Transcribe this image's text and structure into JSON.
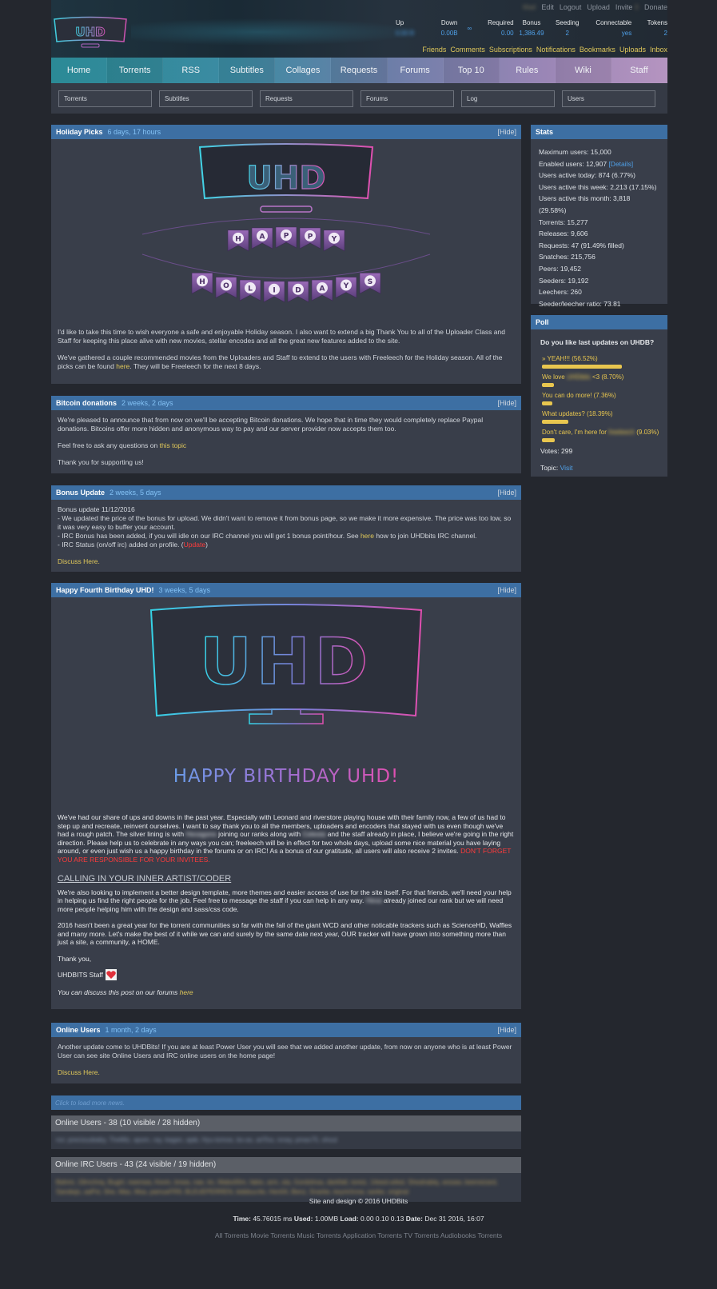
{
  "top_links": {
    "username": "Mail",
    "edit": "Edit",
    "logout": "Logout",
    "upload": "Upload",
    "invite": "Invite",
    "invite_count": "0",
    "donate": "Donate"
  },
  "user_stats": {
    "up_label": "Up",
    "up_value": "0.00 B",
    "down_label": "Down",
    "down_value": "0.00B",
    "ratio_value": "∞",
    "required_label": "Required",
    "required_value": "0.00",
    "bonus_label": "Bonus",
    "bonus_value": "1,386.49",
    "seeding_label": "Seeding",
    "seeding_value": "2",
    "connectable_label": "Connectable",
    "connectable_value": "yes",
    "tokens_label": "Tokens",
    "tokens_value": "2"
  },
  "user_links": [
    "Friends",
    "Comments",
    "Subscriptions",
    "Notifications",
    "Bookmarks",
    "Uploads",
    "Inbox"
  ],
  "nav": [
    "Home",
    "Torrents",
    "RSS",
    "Subtitles",
    "Collages",
    "Requests",
    "Forums",
    "Top 10",
    "Rules",
    "Wiki",
    "Staff"
  ],
  "search_boxes": [
    "Torrents",
    "Subtitles",
    "Requests",
    "Forums",
    "Log",
    "Users"
  ],
  "news": {
    "holiday": {
      "title": "Holiday Picks",
      "age": "6 days, 17 hours",
      "hide": "[Hide]",
      "banner_happy": [
        "H",
        "A",
        "P",
        "P",
        "Y"
      ],
      "banner_holidays": [
        "H",
        "O",
        "L",
        "I",
        "D",
        "A",
        "Y",
        "S"
      ],
      "p1": "I'd like to take this time to wish everyone a safe and enjoyable Holiday season. I also want to extend a big Thank You to all of the Uploader Class and Staff for keeping this place alive with new movies, stellar encodes and all the great new features added to the site.",
      "p2_a": "We've gathered a couple recommended movies from the Uploaders and Staff to extend to the users with Freeleech for the Holiday season. All of the picks can be found ",
      "p2_link": "here",
      "p2_b": ". They will be Freeleech for the next 8 days."
    },
    "bitcoin": {
      "title": "Bitcoin donations",
      "age": "2 weeks, 2 days",
      "hide": "[Hide]",
      "p1": "We're pleased to announce that from now on we'll be accepting Bitcoin donations. We hope that in time they would completely replace Paypal donations. Bitcoins offer more hidden and anonymous way to pay and our server provider now accepts them too.",
      "p2_a": "Feel free to ask any questions on ",
      "p2_link": "this topic",
      "p3": "Thank you for supporting us!"
    },
    "bonus": {
      "title": "Bonus Update",
      "age": "2 weeks, 5 days",
      "hide": "[Hide]",
      "l1": "Bonus update 11/12/2016",
      "l2": "- We updated the price of the bonus for upload. We didn't want to remove it from bonus page, so we make it more expensive. The price was too low, so it was very easy to buffer your account.",
      "l3_a": "- IRC Bonus has been added, if you will idle on our IRC channel you will get 1 bonus point/hour. See ",
      "l3_link": "here",
      "l3_b": " how to join UHDbits IRC channel.",
      "l4_a": "- IRC Status (on/off irc) added on profile. (",
      "l4_red": "Update",
      "l4_b": ")",
      "discuss": "Discuss Here."
    },
    "birthday": {
      "title": "Happy Fourth Birthday UHD!",
      "age": "3 weeks, 5 days",
      "hide": "[Hide]",
      "logo_text": "UHD",
      "headline": "HAPPY BIRTHDAY UHD!",
      "p1_a": "We've had our share of ups and downs in the past year. Especially with Leonard and riverstore playing house with their family now, a few of us had to step up and recreate, reinvent ourselves. I want to say thank you to all the members, uploaders and encoders that stayed with us even though we've had a rough patch. The silver lining is with ",
      "p1_blur1": "Hexagons",
      "p1_b": " joining our ranks along with ",
      "p1_blur2": "Celesta",
      "p1_c": " and the staff already in place, I believe we're going in the right direction.  Please help us to celebrate in any ways you can; freeleech will be in effect for two whole days, upload some nice material you have laying around, or even just wish us a happy birthday in the forums or on IRC! As a bonus of our gratitude, all users will also receive 2 invites. ",
      "p1_red": "DON'T FORGET YOU ARE RESPONSIBLE FOR YOUR INVITEES.",
      "calling": "CALLING IN YOUR INNER ARTIST/CODER",
      "p2_a": "We're also looking to implement a better design template, more themes and easier access of use for the site itself. For that friends, we'll need your help in helping us find the right people for the job. Feel free to message the staff if you can help in any way. ",
      "p2_blur": "Hexa",
      "p2_b": " already joined our rank but we will need more people helping him with the design and sass/css code.",
      "p3": "2016 hasn't been a great year for the torrent communities so far with the fall of the giant WCD and other noticable trackers such as ScienceHD, Waffles and many more. Let's make the best of it while we can and surely by the same date next year, OUR tracker will have grown into something more than just a site, a community, a HOME.",
      "p4": "Thank you,",
      "p5": "UHDBITS Staff",
      "p6_a": "You can discuss this post on our forums ",
      "p6_link": "here"
    },
    "online": {
      "title": "Online Users",
      "age": "1 month, 2 days",
      "hide": "[Hide]",
      "p1": "Another update come to UHDBits! If you are at least Power User you will see that we added another update, from now on anyone who is at least Power User can see site Online Users and IRC online users on the home page!",
      "discuss": "Discuss Here."
    }
  },
  "load_more": "Click to load more news.",
  "online_users": {
    "title": "Online Users - 38 (10 visible / 28 hidden)",
    "list": "nvr, preciousbaby, TheMiz, apom, ray, kagan, ajab, Hyu-tomoe, bo-ax, artToo, ivnay, pmax75, shout"
  },
  "irc_users": {
    "title": "Online IRC Users - 43 (24 visible / 19 hidden)",
    "list": "Bahmi, 19rnchnq, Bugirl, nwenwa, Kevin, bnwa, nae, kn, Mabo00m, fabio, arm, sta, Gordolnsa, darkfall, toreiz, 14eed-a4ed, Sheahabiq, wosaw, beerwizard, Sandwjo, aaPsl, She, Mas, Msa, pamueFR9, BLEUEPERREN, biddsuc4e, Hen04, Benz, Snarbe, keyrichrow, sanke, original"
  },
  "stats": {
    "title": "Stats",
    "lines": [
      "Maximum users: 15,000",
      "Users active today: 874 (6.77%)",
      "Users active this week: 2,213 (17.15%)",
      "Users active this month: 3,818 (29.58%)",
      "Torrents: 15,277",
      "Releases: 9,606",
      "Requests: 47 (91.49% filled)",
      "Snatches: 215,756",
      "Peers: 19,452",
      "Seeders: 19,192",
      "Leechers: 260",
      "Seeder/leecher ratio: 73.81"
    ],
    "enabled": "Enabled users: 12,907 ",
    "details": "[Details]"
  },
  "poll": {
    "title": "Poll",
    "question": "Do you like last updates on UHDB?",
    "options": [
      {
        "label": "» YEAH!!! (56.52%)",
        "pct": 56.52
      },
      {
        "label": "We love UHDbits <3 (8.70%)",
        "pct": 8.7
      },
      {
        "label": "You can do more! (7.36%)",
        "pct": 7.36
      },
      {
        "label": "What updates? (18.39%)",
        "pct": 18.39
      },
      {
        "label": "Don't care, I'm here for freeleech (9.03%)",
        "pct": 9.03
      }
    ],
    "votes": "Votes: 299",
    "topic_label": "Topic: ",
    "topic_link": "Visit"
  },
  "footer": {
    "line1": "Site and design © 2016 UHDBits",
    "time_label": "Time:",
    "time_value": " 45.76015 ms ",
    "used_label": "Used:",
    "used_value": " 1.00MB ",
    "load_label": "Load:",
    "load_value": " 0.00 0.10 0.13 ",
    "date_label": "Date:",
    "date_value": " Dec 31 2016, 16:07",
    "links": "All Torrents Movie Torrents Music Torrents Application Torrents TV Torrents Audiobooks Torrents"
  },
  "colors": {
    "nav_start": "#2b8a96",
    "nav_end": "#b594c0",
    "box_header": "#3d6fa3",
    "link_yellow": "#e0c85a",
    "accent_blue": "#4fa0e8"
  }
}
